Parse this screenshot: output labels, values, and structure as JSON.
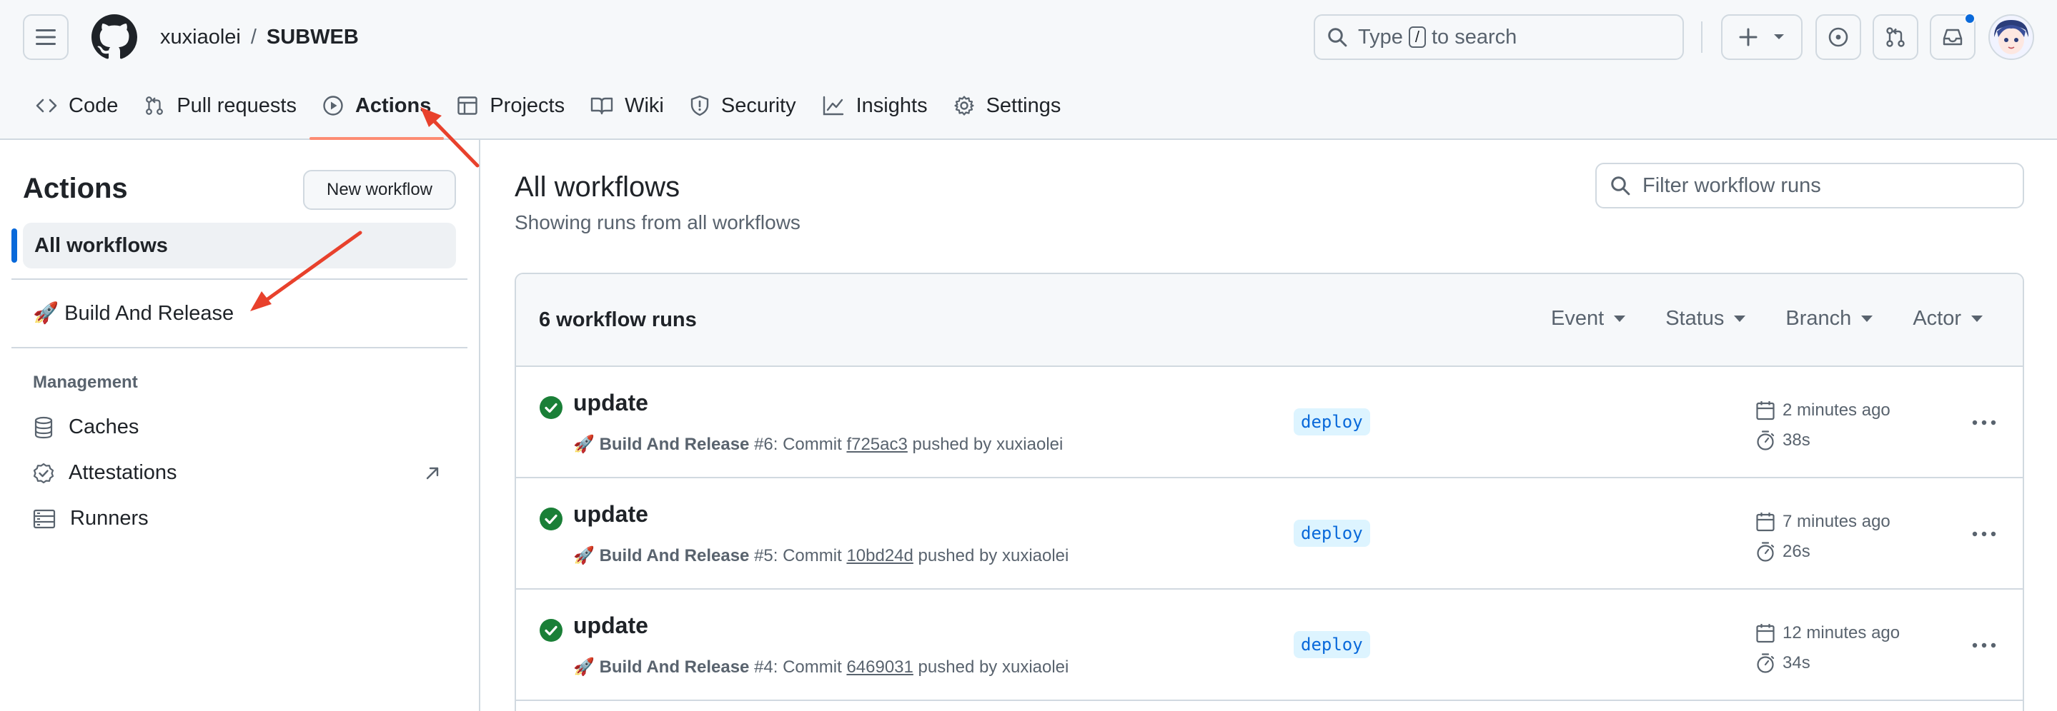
{
  "header": {
    "repo_owner": "xuxiaolei",
    "repo_sep": "/",
    "repo_name": "SUBWEB",
    "search_prefix": "Type",
    "search_key": "/",
    "search_suffix": "to search"
  },
  "tabs": [
    {
      "label": "Code",
      "icon": "code-icon"
    },
    {
      "label": "Pull requests",
      "icon": "pull-request-icon"
    },
    {
      "label": "Actions",
      "icon": "play-icon",
      "selected": true
    },
    {
      "label": "Projects",
      "icon": "table-icon"
    },
    {
      "label": "Wiki",
      "icon": "book-icon"
    },
    {
      "label": "Security",
      "icon": "shield-icon"
    },
    {
      "label": "Insights",
      "icon": "graph-icon"
    },
    {
      "label": "Settings",
      "icon": "gear-icon"
    }
  ],
  "sidebar": {
    "title": "Actions",
    "new_workflow": "New workflow",
    "all_workflows": "All workflows",
    "workflow_item": "🚀 Build And Release",
    "management_heading": "Management",
    "caches": "Caches",
    "attestations": "Attestations",
    "runners": "Runners"
  },
  "main": {
    "title": "All workflows",
    "subtitle": "Showing runs from all workflows",
    "filter_placeholder": "Filter workflow runs",
    "runs_count": "6 workflow runs",
    "filters": [
      "Event",
      "Status",
      "Branch",
      "Actor"
    ]
  },
  "runs": [
    {
      "title": "update",
      "emoji": "🚀",
      "workflow": "Build And Release",
      "number_text": "#6: Commit",
      "sha": "f725ac3",
      "pushed_by": "pushed by xuxiaolei",
      "branch": "deploy",
      "when": "2 minutes ago",
      "duration": "38s"
    },
    {
      "title": "update",
      "emoji": "🚀",
      "workflow": "Build And Release",
      "number_text": "#5: Commit",
      "sha": "10bd24d",
      "pushed_by": "pushed by xuxiaolei",
      "branch": "deploy",
      "when": "7 minutes ago",
      "duration": "26s"
    },
    {
      "title": "update",
      "emoji": "🚀",
      "workflow": "Build And Release",
      "number_text": "#4: Commit",
      "sha": "6469031",
      "pushed_by": "pushed by xuxiaolei",
      "branch": "deploy",
      "when": "12 minutes ago",
      "duration": "34s"
    }
  ],
  "colors": {
    "accent": "#0969da",
    "tab_underline": "#fd8c73",
    "success": "#1a7f37",
    "annotation": "#e8412c"
  }
}
